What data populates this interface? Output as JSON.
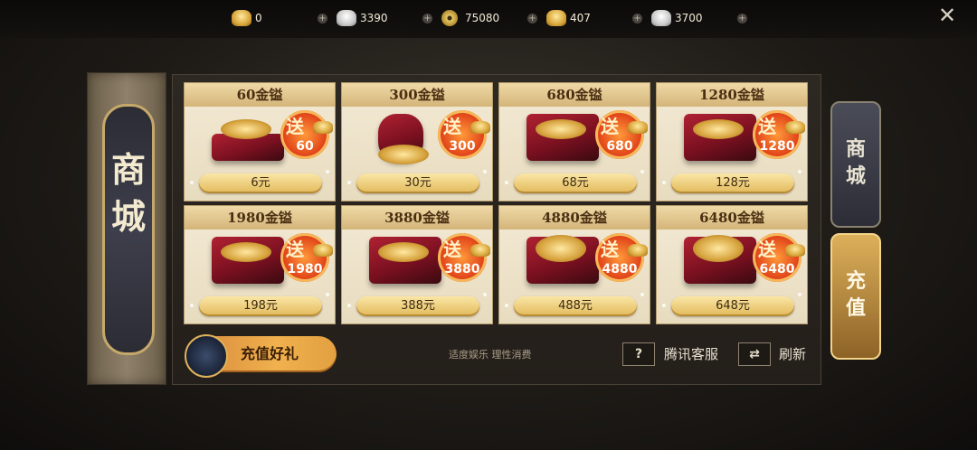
{
  "currencies": [
    {
      "icon": "gold-ingot-icon",
      "value": "0"
    },
    {
      "icon": "silver-ingot-icon",
      "value": "3390"
    },
    {
      "icon": "copper-coin-icon",
      "value": "75080"
    },
    {
      "icon": "gold-ingot-icon",
      "value": "407"
    },
    {
      "icon": "silver-ingot-icon",
      "value": "3700"
    }
  ],
  "close_symbol": "✕",
  "banner": {
    "title": "商城"
  },
  "bonus_badge_char": "送",
  "cards": [
    {
      "title": "60金镒",
      "bonus": "60",
      "price": "6元"
    },
    {
      "title": "300金镒",
      "bonus": "300",
      "price": "30元"
    },
    {
      "title": "680金镒",
      "bonus": "680",
      "price": "68元"
    },
    {
      "title": "1280金镒",
      "bonus": "1280",
      "price": "128元"
    },
    {
      "title": "1980金镒",
      "bonus": "1980",
      "price": "198元"
    },
    {
      "title": "3880金镒",
      "bonus": "3880",
      "price": "388元"
    },
    {
      "title": "4880金镒",
      "bonus": "4880",
      "price": "488元"
    },
    {
      "title": "6480金镒",
      "bonus": "6480",
      "price": "648元"
    }
  ],
  "bottom": {
    "gift_button": "充值好礼",
    "notice": "适度娱乐 理性消费",
    "help_symbol": "?",
    "service_label": "腾讯客服",
    "refresh_symbol": "⇄",
    "refresh_label": "刷新"
  },
  "tabs": {
    "shop": "商城",
    "recharge": "充值"
  },
  "colors": {
    "accent_gold": "#e1b95a",
    "badge_red": "#e2461a",
    "panel_dark": "#241f1a"
  }
}
